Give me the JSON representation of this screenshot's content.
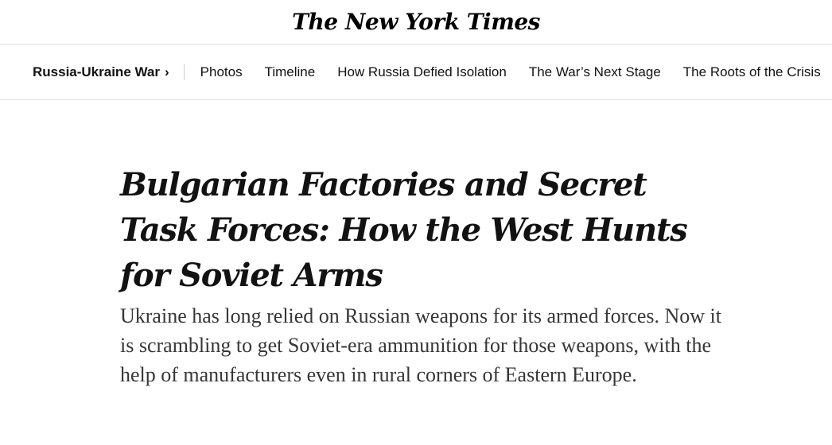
{
  "masthead": {
    "logo_text": "The New York Times"
  },
  "subnav": {
    "section_label": "Russia-Ukraine War",
    "chevron": "›",
    "items": [
      {
        "label": "Photos"
      },
      {
        "label": "Timeline"
      },
      {
        "label": "How Russia Defied Isolation"
      },
      {
        "label": "The War’s Next Stage"
      },
      {
        "label": "The Roots of the Crisis"
      }
    ]
  },
  "article": {
    "headline": "Bulgarian Factories and Secret Task Forces: How the West Hunts for Soviet Arms",
    "summary": "Ukraine has long relied on Russian weapons for its armed forces. Now it is scrambling to get Soviet-era ammunition for those weapons, with the help of manufacturers even in rural corners of Eastern Europe."
  }
}
